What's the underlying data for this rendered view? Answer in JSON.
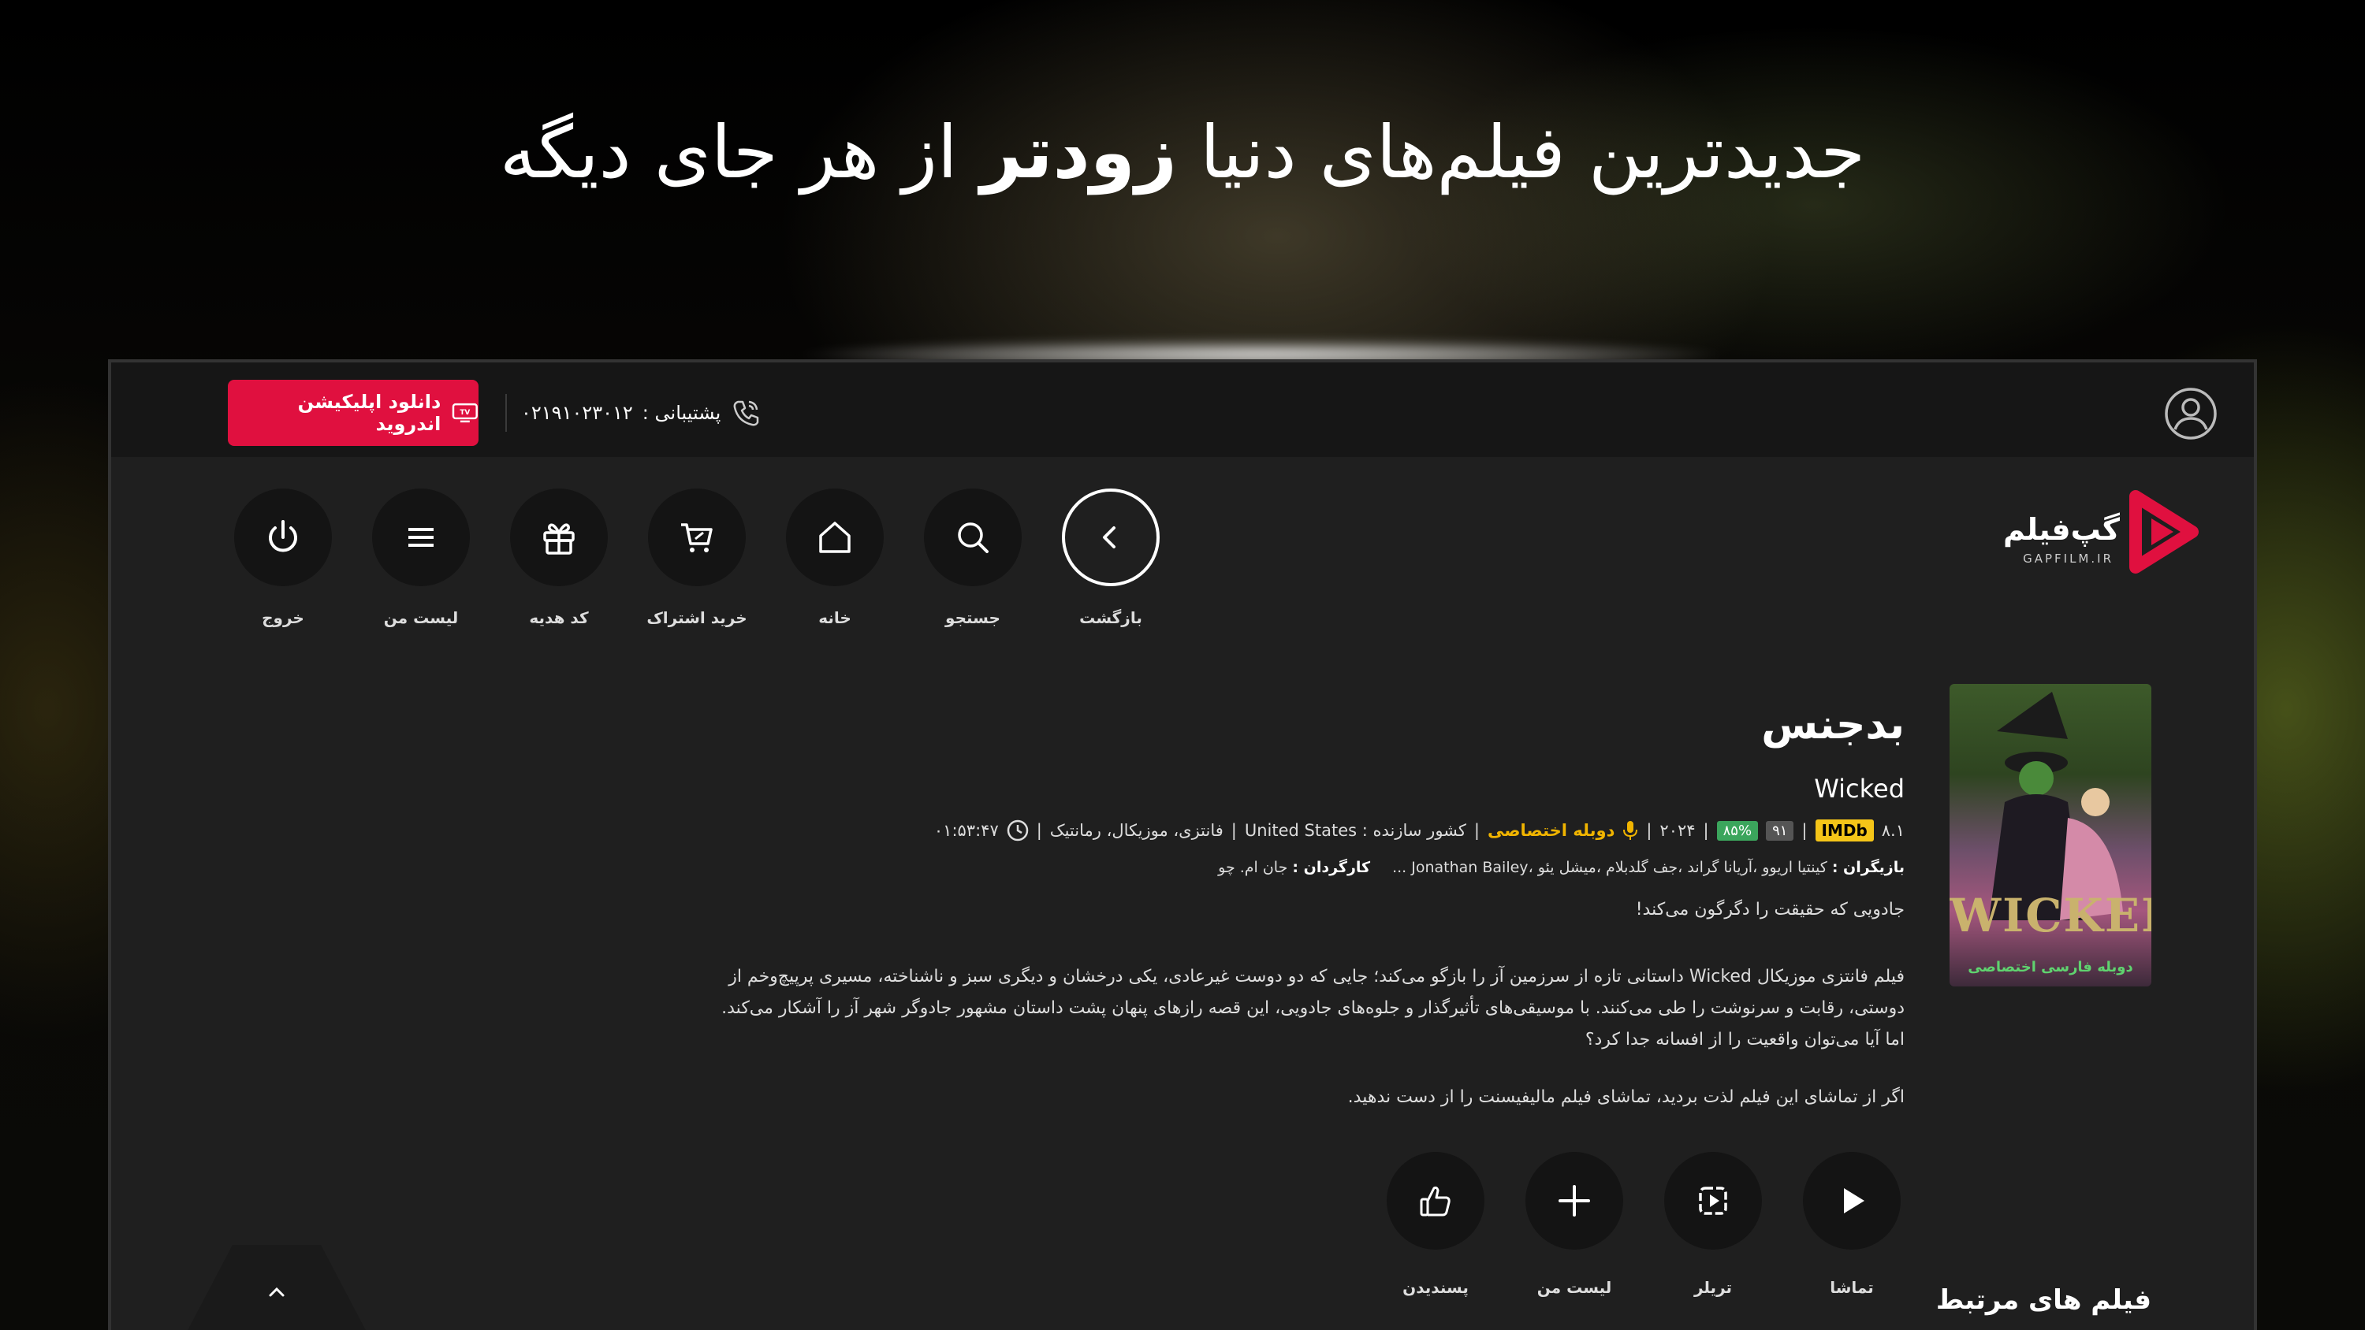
{
  "headline": {
    "before": "جدیدترین فیلم‌های دنیا ",
    "bold": "زودتر",
    "after": " از هر جای دیگه"
  },
  "topbar": {
    "download_label": "دانلود اپلیکیشن اندروید",
    "support_label": "پشتیبانی :",
    "support_phone": "۰۲۱۹۱۰۲۳۰۱۲"
  },
  "nav": {
    "items": [
      {
        "label": "بازگشت",
        "icon": "chevron-left-icon"
      },
      {
        "label": "جستجو",
        "icon": "search-icon"
      },
      {
        "label": "خانه",
        "icon": "home-icon"
      },
      {
        "label": "خرید اشتراک",
        "icon": "cart-icon"
      },
      {
        "label": "کد هدیه",
        "icon": "gift-icon"
      },
      {
        "label": "لیست من",
        "icon": "menu-icon"
      },
      {
        "label": "خروج",
        "icon": "power-icon"
      }
    ]
  },
  "logo": {
    "name_fa": "گپ‌فیلم",
    "name_en": "GAPFILM.IR",
    "accent": "#e0103f"
  },
  "poster": {
    "title": "WICKED",
    "subtitle": "دوبله فارسی اختصاصی"
  },
  "movie": {
    "title_fa": "بدجنس",
    "title_en": "Wicked",
    "imdb_score": "۸.۱",
    "imdb_label": "IMDb",
    "rating_count": "۹۱",
    "rating_percent": "۸۵%",
    "year": "۲۰۲۴",
    "dub_label": "دوبله اختصاصی",
    "country": "کشور سازنده : United States",
    "genres": "فانتزی، موزیکال، رمانتیک",
    "duration": "۰۱:۵۳:۴۷",
    "cast_label": "بازیگران :",
    "cast": "کینتیا اریوو ،آریانا گراند ،جف گلدبلام ،میشل یئو ،Jonathan Bailey ...",
    "director_label": "کارگردان :",
    "director": "جان ام. چو",
    "tagline": "جادویی که حقیقت را دگرگون می‌کند!",
    "description": [
      "فیلم فانتزی موزیکال Wicked داستانی تازه از سرزمین آز را بازگو می‌کند؛ جایی که دو دوست غیرعادی، یکی درخشان و دیگری سبز و ناشناخته، مسیری پرپیچ‌وخم از",
      "دوستی، رقابت و سرنوشت را طی می‌کنند. با موسیقی‌های تأثیرگذار و جلوه‌های جادویی، این قصه رازهای پنهان پشت داستان مشهور جادوگر شهر آز را آشکار می‌کند.",
      "اما آیا می‌توان واقعیت را از افسانه جدا کرد؟"
    ],
    "footer_line": "اگر از تماشای این فیلم لذت بردید، تماشای فیلم مالیفیسنت را از دست ندهید."
  },
  "actions": [
    {
      "label": "تماشا",
      "icon": "play-icon"
    },
    {
      "label": "تریلر",
      "icon": "trailer-icon"
    },
    {
      "label": "لیست من",
      "icon": "plus-icon"
    },
    {
      "label": "پسندیدن",
      "icon": "thumbs-up-icon"
    }
  ],
  "related_title": "فیلم های مرتبط"
}
